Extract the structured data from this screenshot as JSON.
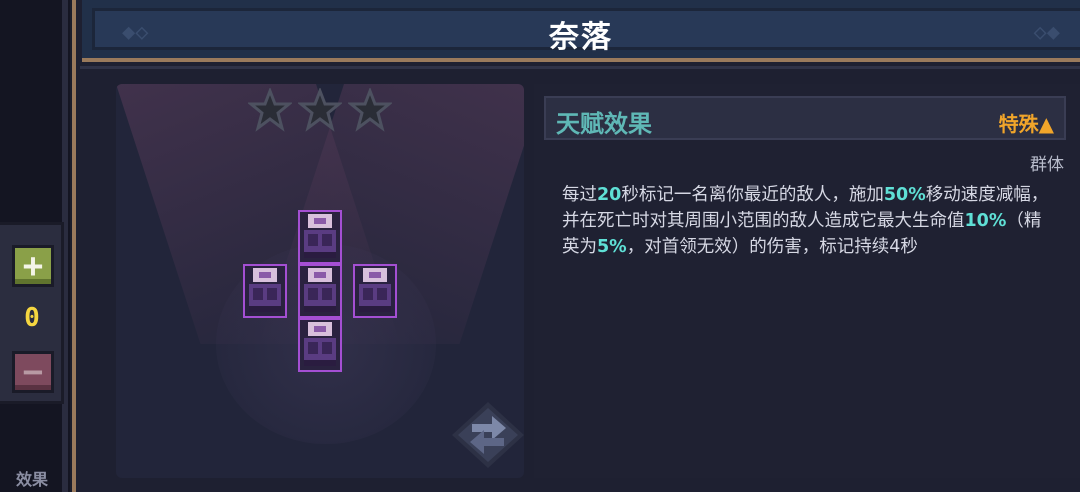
{
  "window": {
    "title": "奈落"
  },
  "sidebar": {
    "plus_label": "+",
    "count": "0",
    "minus_label": "−",
    "bottom_tab": "效果"
  },
  "talent": {
    "star_count": 3,
    "stars_filled": 0,
    "effect_heading": "天赋效果",
    "rarity_label": "特殊▲",
    "target_tag": "群体",
    "description_parts": [
      {
        "t": "每过",
        "h": false
      },
      {
        "t": "20",
        "h": true
      },
      {
        "t": "秒标记一名离你最近的敌人，施加",
        "h": false
      },
      {
        "t": "50%",
        "h": true
      },
      {
        "t": "移动速度减幅，并在死亡时对其周围小范围的敌人造成它最大生命值",
        "h": false
      },
      {
        "t": "10%",
        "h": true
      },
      {
        "t": "（精英为",
        "h": false
      },
      {
        "t": "5%",
        "h": true
      },
      {
        "t": "，对首领无效）的伤害，标记持续4秒",
        "h": false
      }
    ]
  },
  "icons": {
    "star": "star-outline-icon",
    "refresh": "swap-arrows-icon",
    "piece": "chest-piece-icon"
  },
  "colors": {
    "accent_highlight": "#5fe0d6",
    "rarity": "#f1a52a",
    "heading": "#5fb8b6",
    "piece_border": "#a44fd3"
  }
}
